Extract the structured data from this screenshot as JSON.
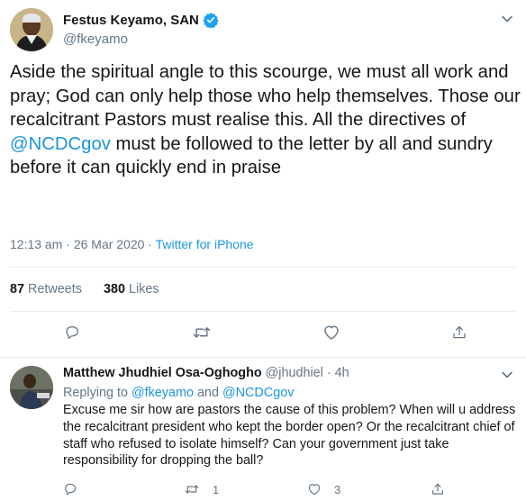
{
  "tweet": {
    "display_name": "Festus Keyamo, SAN",
    "handle": "@fkeyamo",
    "text_before": "Aside the spiritual angle to this scourge, we must all work and pray; God can only help those who help themselves. Those our recalcitrant Pastors must realise this. All the directives of ",
    "mention": "@NCDCgov",
    "text_after": " must be followed to the letter by all and sundry before it can quickly end in praise",
    "timestamp": "12:13 am · 26 Mar 2020 · ",
    "source": "Twitter for iPhone",
    "retweets_count": "87",
    "retweets_label": " Retweets",
    "likes_count": "380",
    "likes_label": " Likes"
  },
  "reply": {
    "display_name": "Matthew Jhudhiel Osa-Oghogho",
    "handle_time": " @jhudhiel · 4h",
    "replying_prefix": "Replying to ",
    "replying_mention_1": "@fkeyamo",
    "replying_and": " and ",
    "replying_mention_2": "@NCDCgov",
    "text": "Excuse me sir how are pastors the cause of this problem? When will u address the recalcitrant president who kept the border open? Or the recalcitrant chief of staff who refused to isolate himself? Can your government just take responsibility for dropping the ball?",
    "retweet_count": "1",
    "like_count": "3"
  },
  "icons": {
    "verified": "verified-badge-icon",
    "caret": "chevron-down-icon",
    "reply": "reply-icon",
    "retweet": "retweet-icon",
    "like": "heart-icon",
    "share": "share-icon"
  },
  "colors": {
    "link": "#1b95e0",
    "muted": "#657786",
    "text": "#14171a",
    "border": "#e6ecf0"
  }
}
